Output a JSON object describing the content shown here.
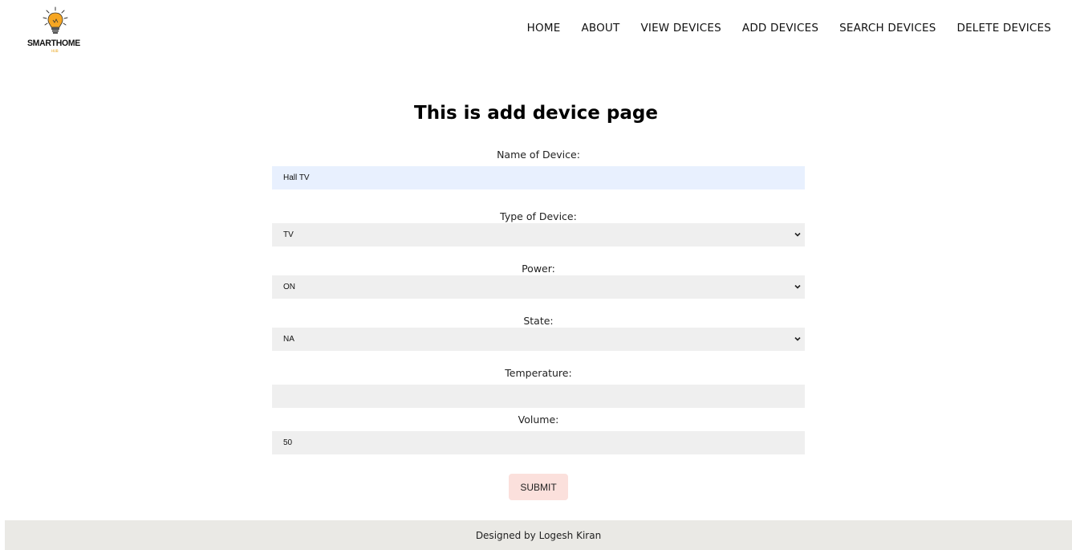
{
  "brand": {
    "name": "SMARTHOME",
    "sub": "HUB"
  },
  "nav": {
    "items": [
      {
        "label": "HOME"
      },
      {
        "label": "ABOUT"
      },
      {
        "label": "VIEW DEVICES"
      },
      {
        "label": "ADD DEVICES"
      },
      {
        "label": "SEARCH DEVICES"
      },
      {
        "label": "DELETE DEVICES"
      }
    ]
  },
  "page": {
    "title": "This is add device page"
  },
  "form": {
    "name": {
      "label": "Name of Device:",
      "value": "Hall TV"
    },
    "type": {
      "label": "Type of Device:",
      "value": "TV"
    },
    "power": {
      "label": "Power:",
      "value": "ON"
    },
    "state": {
      "label": "State:",
      "value": "NA"
    },
    "temperature": {
      "label": "Temperature:",
      "value": ""
    },
    "volume": {
      "label": "Volume:",
      "value": "50"
    },
    "submit_label": "SUBMIT"
  },
  "footer": {
    "text": "Designed by Logesh Kiran"
  },
  "colors": {
    "accent": "#e8a317",
    "submit_bg": "#fbe0dc",
    "footer_bg": "#eae9e5",
    "field_bg": "#efefef",
    "autofill_bg": "#e8f0fe"
  }
}
